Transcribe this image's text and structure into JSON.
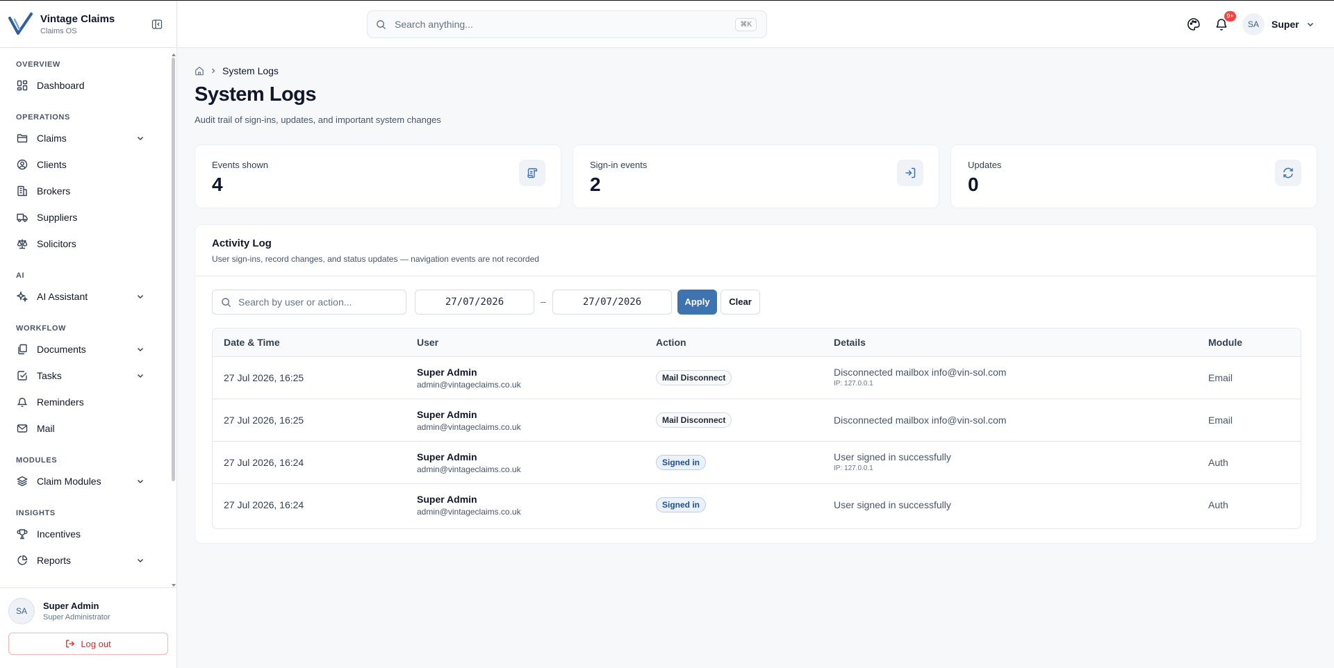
{
  "brand": {
    "name": "Vintage Claims",
    "subtitle": "Claims OS"
  },
  "sidebar": {
    "sections": [
      {
        "title": "OVERVIEW",
        "items": [
          {
            "label": "Dashboard",
            "icon": "dashboard-icon"
          }
        ]
      },
      {
        "title": "OPERATIONS",
        "items": [
          {
            "label": "Claims",
            "icon": "folder-icon",
            "expandable": true
          },
          {
            "label": "Clients",
            "icon": "user-circle-icon"
          },
          {
            "label": "Brokers",
            "icon": "building-icon"
          },
          {
            "label": "Suppliers",
            "icon": "truck-icon"
          },
          {
            "label": "Solicitors",
            "icon": "scale-icon"
          }
        ]
      },
      {
        "title": "AI",
        "items": [
          {
            "label": "AI Assistant",
            "icon": "sparkles-icon",
            "expandable": true
          }
        ]
      },
      {
        "title": "WORKFLOW",
        "items": [
          {
            "label": "Documents",
            "icon": "documents-icon",
            "expandable": true
          },
          {
            "label": "Tasks",
            "icon": "checkbox-icon",
            "expandable": true
          },
          {
            "label": "Reminders",
            "icon": "bell-icon"
          },
          {
            "label": "Mail",
            "icon": "mail-icon"
          }
        ]
      },
      {
        "title": "MODULES",
        "items": [
          {
            "label": "Claim Modules",
            "icon": "layers-icon",
            "expandable": true
          }
        ]
      },
      {
        "title": "INSIGHTS",
        "items": [
          {
            "label": "Incentives",
            "icon": "trophy-icon"
          },
          {
            "label": "Reports",
            "icon": "pie-chart-icon",
            "expandable": true
          }
        ]
      }
    ],
    "user": {
      "initials": "SA",
      "name": "Super Admin",
      "role": "Super Administrator"
    },
    "logout_label": "Log out"
  },
  "header": {
    "search_placeholder": "Search anything...",
    "search_shortcut": "⌘K",
    "notification_badge": "9+",
    "user_initials": "SA",
    "user_name": "Super"
  },
  "page": {
    "breadcrumb": "System Logs",
    "title": "System Logs",
    "subtitle": "Audit trail of sign-ins, updates, and important system changes"
  },
  "stats": [
    {
      "label": "Events shown",
      "value": "4",
      "icon": "scroll-icon"
    },
    {
      "label": "Sign-in events",
      "value": "2",
      "icon": "sign-in-icon"
    },
    {
      "label": "Updates",
      "value": "0",
      "icon": "refresh-icon"
    }
  ],
  "activity": {
    "title": "Activity Log",
    "subtitle": "User sign-ins, record changes, and status updates — navigation events are not recorded",
    "search_placeholder": "Search by user or action...",
    "date_from": "27/07/2026",
    "date_to": "27/07/2026",
    "date_separator": "–",
    "apply_label": "Apply",
    "clear_label": "Clear",
    "columns": [
      "Date & Time",
      "User",
      "Action",
      "Details",
      "Module"
    ],
    "rows": [
      {
        "datetime": "27 Jul 2026, 16:25",
        "user": "Super Admin",
        "email": "admin@vintageclaims.co.uk",
        "action": "Mail Disconnect",
        "action_style": "gray",
        "details": "Disconnected mailbox info@vin-sol.com",
        "ip": "IP: 127.0.0.1",
        "module": "Email"
      },
      {
        "datetime": "27 Jul 2026, 16:25",
        "user": "Super Admin",
        "email": "admin@vintageclaims.co.uk",
        "action": "Mail Disconnect",
        "action_style": "gray",
        "details": "Disconnected mailbox info@vin-sol.com",
        "ip": "",
        "module": "Email"
      },
      {
        "datetime": "27 Jul 2026, 16:24",
        "user": "Super Admin",
        "email": "admin@vintageclaims.co.uk",
        "action": "Signed in",
        "action_style": "blue",
        "details": "User signed in successfully",
        "ip": "IP: 127.0.0.1",
        "module": "Auth"
      },
      {
        "datetime": "27 Jul 2026, 16:24",
        "user": "Super Admin",
        "email": "admin@vintageclaims.co.uk",
        "action": "Signed in",
        "action_style": "blue",
        "details": "User signed in successfully",
        "ip": "",
        "module": "Auth"
      }
    ]
  },
  "colors": {
    "accent": "#3d73b0",
    "danger": "#dc2626",
    "badge": "#ef4444"
  }
}
